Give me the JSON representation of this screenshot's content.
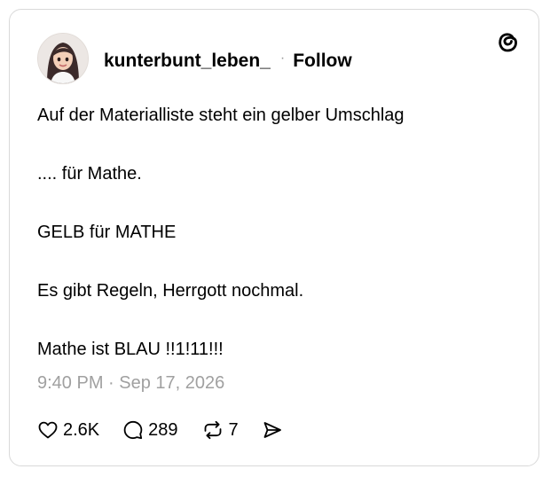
{
  "post": {
    "author": {
      "username": "kunterbunt_leben_",
      "separator": "·",
      "follow_label": "Follow"
    },
    "paragraphs": [
      "Auf der Materialliste steht ein gelber Umschlag",
      ".... für Mathe.",
      "GELB für MATHE",
      "Es gibt Regeln, Herrgott nochmal.",
      "Mathe ist BLAU !!1!11!!!"
    ],
    "timestamp": "9:40 PM · Sep 17, 2026",
    "actions": {
      "likes": "2.6K",
      "replies": "289",
      "reposts": "7"
    }
  },
  "icons": {
    "brand": "threads-logo-icon",
    "like": "heart-icon",
    "reply": "speech-bubble-icon",
    "repost": "repost-arrows-icon",
    "share": "send-icon"
  },
  "colors": {
    "text": "#000000",
    "muted": "#a0a0a0",
    "border": "#d9d9d9"
  }
}
